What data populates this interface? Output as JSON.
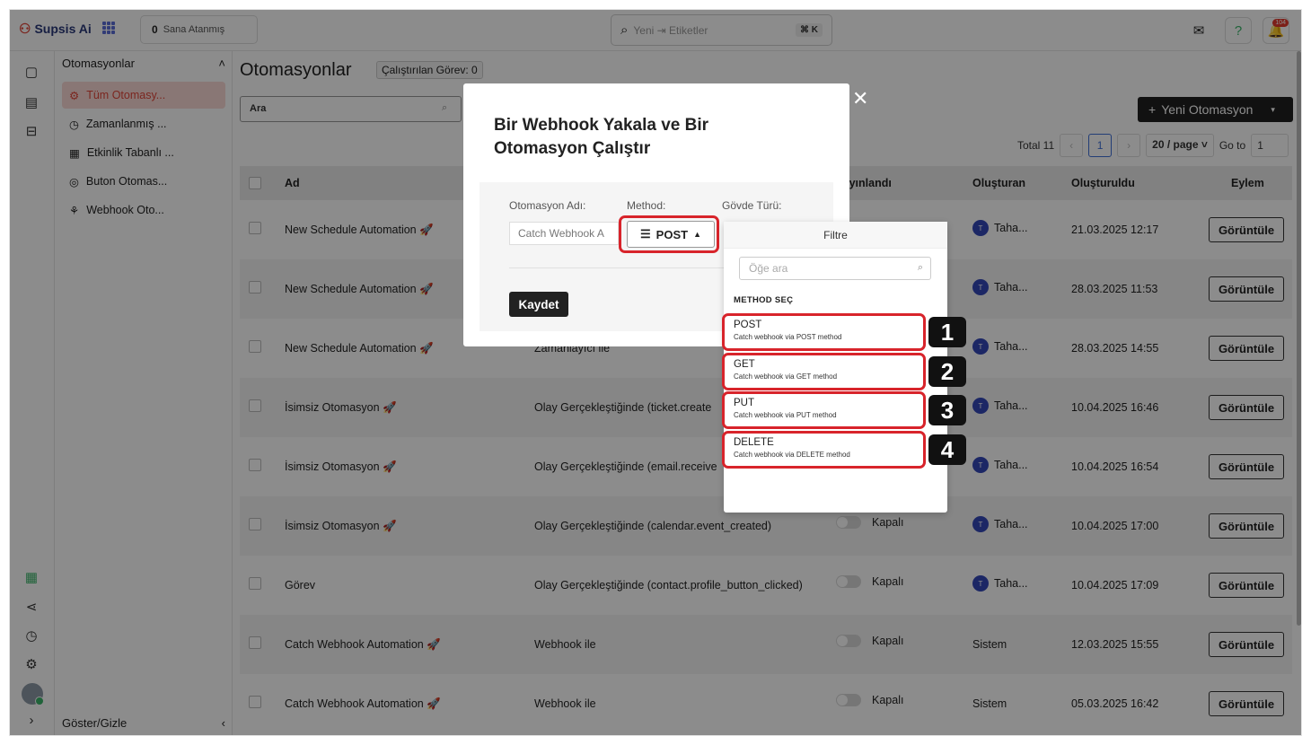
{
  "app": {
    "name": "Supsis Ai",
    "assigned_count": "0",
    "assigned_label": "Sana Atanmış"
  },
  "search": {
    "placeholder": "Yeni ⇥ Etiketler",
    "shortcut": "⌘ K"
  },
  "notifications": {
    "count": "104"
  },
  "sidebar": {
    "title": "Otomasyonlar",
    "items": [
      {
        "label": "Tüm Otomasy...",
        "icon": "gear-icon"
      },
      {
        "label": "Zamanlanmış ...",
        "icon": "history-icon"
      },
      {
        "label": "Etkinlik Tabanlı ...",
        "icon": "calendar-icon"
      },
      {
        "label": "Buton Otomas...",
        "icon": "button-icon"
      },
      {
        "label": "Webhook Oto...",
        "icon": "webhook-icon"
      }
    ],
    "footer": "Göster/Gizle"
  },
  "main": {
    "title": "Otomasyonlar",
    "running_badge": "Çalıştırılan Görev: 0",
    "search_placeholder": "Ara",
    "new_button": "Yeni Otomasyon",
    "pagination": {
      "total": "Total 11",
      "current": "1",
      "page_size": "20 / page",
      "goto_label": "Go to",
      "goto_value": "1"
    },
    "columns": {
      "name": "Ad",
      "trigger": "",
      "published": "Yayınlandı",
      "creator": "Oluşturan",
      "created": "Oluşturuldu",
      "action": "Eylem"
    },
    "rows": [
      {
        "name": "New Schedule Automation 🚀",
        "trigger": "",
        "status": "",
        "creator": "Taha...",
        "date": "21.03.2025 12:17",
        "action": "Görüntüle"
      },
      {
        "name": "New Schedule Automation 🚀",
        "trigger": "",
        "status": "",
        "creator": "Taha...",
        "date": "28.03.2025 11:53",
        "action": "Görüntüle"
      },
      {
        "name": "New Schedule Automation 🚀",
        "trigger": "Zamanlayıcı ile",
        "status": "",
        "creator": "Taha...",
        "date": "28.03.2025 14:55",
        "action": "Görüntüle"
      },
      {
        "name": "İsimsiz Otomasyon 🚀",
        "trigger": "Olay Gerçekleştiğinde (ticket.create",
        "status": "",
        "creator": "Taha...",
        "date": "10.04.2025 16:46",
        "action": "Görüntüle"
      },
      {
        "name": "İsimsiz Otomasyon 🚀",
        "trigger": "Olay Gerçekleştiğinde (email.receive",
        "status": "",
        "creator": "Taha...",
        "date": "10.04.2025 16:54",
        "action": "Görüntüle"
      },
      {
        "name": "İsimsiz Otomasyon 🚀",
        "trigger": "Olay Gerçekleştiğinde (calendar.event_created)",
        "status": "Kapalı",
        "creator": "Taha...",
        "date": "10.04.2025 17:00",
        "action": "Görüntüle"
      },
      {
        "name": "Görev",
        "trigger": "Olay Gerçekleştiğinde (contact.profile_button_clicked)",
        "status": "Kapalı",
        "creator": "Taha...",
        "date": "10.04.2025 17:09",
        "action": "Görüntüle"
      },
      {
        "name": "Catch Webhook Automation 🚀",
        "trigger": "Webhook ile",
        "status": "Kapalı",
        "creator": "Sistem",
        "date": "12.03.2025 15:55",
        "action": "Görüntüle"
      },
      {
        "name": "Catch Webhook Automation 🚀",
        "trigger": "Webhook ile",
        "status": "Kapalı",
        "creator": "Sistem",
        "date": "05.03.2025 16:42",
        "action": "Görüntüle"
      }
    ]
  },
  "modal": {
    "title": "Bir Webhook Yakala ve Bir Otomasyon Çalıştır",
    "name_label": "Otomasyon Adı:",
    "name_value": "Catch Webhook A",
    "method_label": "Method:",
    "method_value": "POST",
    "body_label": "Gövde Türü:",
    "save_button": "Kaydet"
  },
  "dropdown": {
    "header": "Filtre",
    "search_placeholder": "Öğe ara",
    "section": "METHOD SEÇ",
    "options": [
      {
        "title": "POST",
        "sub": "Catch webhook via POST method",
        "num": "1"
      },
      {
        "title": "GET",
        "sub": "Catch webhook via GET method",
        "num": "2"
      },
      {
        "title": "PUT",
        "sub": "Catch webhook via PUT method",
        "num": "3"
      },
      {
        "title": "DELETE",
        "sub": "Catch webhook via DELETE method",
        "num": "4"
      }
    ]
  },
  "colors": {
    "accent": "#e0463a",
    "highlight": "#d8242b",
    "primary_dark": "#1f1f1f"
  }
}
